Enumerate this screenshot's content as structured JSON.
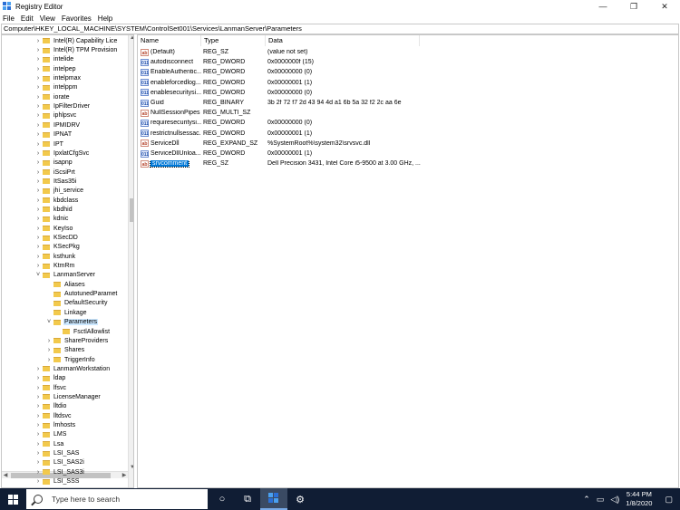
{
  "window": {
    "title": "Registry Editor",
    "controls": [
      "—",
      "❐",
      "✕"
    ]
  },
  "menu": [
    "File",
    "Edit",
    "View",
    "Favorites",
    "Help"
  ],
  "address": "Computer\\HKEY_LOCAL_MACHINE\\SYSTEM\\ControlSet001\\Services\\LanmanServer\\Parameters",
  "tree": {
    "items": [
      {
        "label": "Intel(R) Capability Lice",
        "level": 0,
        "expander": "›"
      },
      {
        "label": "Intel(R) TPM Provision",
        "level": 0,
        "expander": "›"
      },
      {
        "label": "intelide",
        "level": 0,
        "expander": "›"
      },
      {
        "label": "intelpep",
        "level": 0,
        "expander": "›"
      },
      {
        "label": "intelpmax",
        "level": 0,
        "expander": "›"
      },
      {
        "label": "intelppm",
        "level": 0,
        "expander": "›"
      },
      {
        "label": "iorate",
        "level": 0,
        "expander": "›"
      },
      {
        "label": "IpFilterDriver",
        "level": 0,
        "expander": "›"
      },
      {
        "label": "iphlpsvc",
        "level": 0,
        "expander": "›"
      },
      {
        "label": "IPMIDRV",
        "level": 0,
        "expander": "›"
      },
      {
        "label": "IPNAT",
        "level": 0,
        "expander": "›"
      },
      {
        "label": "IPT",
        "level": 0,
        "expander": "›"
      },
      {
        "label": "IpxlatCfgSvc",
        "level": 0,
        "expander": "›"
      },
      {
        "label": "isapnp",
        "level": 0,
        "expander": "›"
      },
      {
        "label": "iScsiPrt",
        "level": 0,
        "expander": "›"
      },
      {
        "label": "ItSas35i",
        "level": 0,
        "expander": "›"
      },
      {
        "label": "jhi_service",
        "level": 0,
        "expander": "›"
      },
      {
        "label": "kbdclass",
        "level": 0,
        "expander": "›"
      },
      {
        "label": "kbdhid",
        "level": 0,
        "expander": "›"
      },
      {
        "label": "kdnic",
        "level": 0,
        "expander": "›"
      },
      {
        "label": "KeyIso",
        "level": 0,
        "expander": "›"
      },
      {
        "label": "KSecDD",
        "level": 0,
        "expander": "›"
      },
      {
        "label": "KSecPkg",
        "level": 0,
        "expander": "›"
      },
      {
        "label": "ksthunk",
        "level": 0,
        "expander": "›"
      },
      {
        "label": "KtmRm",
        "level": 0,
        "expander": "›"
      },
      {
        "label": "LanmanServer",
        "level": 0,
        "expander": "˅"
      },
      {
        "label": "Aliases",
        "level": 1,
        "expander": ""
      },
      {
        "label": "AutotunedParamet",
        "level": 1,
        "expander": ""
      },
      {
        "label": "DefaultSecurity",
        "level": 1,
        "expander": ""
      },
      {
        "label": "Linkage",
        "level": 1,
        "expander": ""
      },
      {
        "label": "Parameters",
        "level": 1,
        "expander": "˅",
        "selected": true
      },
      {
        "label": "FsctlAllowlist",
        "level": 2,
        "expander": ""
      },
      {
        "label": "ShareProviders",
        "level": 1,
        "expander": "›"
      },
      {
        "label": "Shares",
        "level": 1,
        "expander": "›"
      },
      {
        "label": "TriggerInfo",
        "level": 1,
        "expander": "›"
      },
      {
        "label": "LanmanWorkstation",
        "level": 0,
        "expander": "›"
      },
      {
        "label": "ldap",
        "level": 0,
        "expander": "›"
      },
      {
        "label": "lfsvc",
        "level": 0,
        "expander": "›"
      },
      {
        "label": "LicenseManager",
        "level": 0,
        "expander": "›"
      },
      {
        "label": "lltdio",
        "level": 0,
        "expander": "›"
      },
      {
        "label": "lltdsvc",
        "level": 0,
        "expander": "›"
      },
      {
        "label": "lmhosts",
        "level": 0,
        "expander": "›"
      },
      {
        "label": "LMS",
        "level": 0,
        "expander": "›"
      },
      {
        "label": "Lsa",
        "level": 0,
        "expander": "›"
      },
      {
        "label": "LSI_SAS",
        "level": 0,
        "expander": "›"
      },
      {
        "label": "LSI_SAS2i",
        "level": 0,
        "expander": "›"
      },
      {
        "label": "LSI_SAS3i",
        "level": 0,
        "expander": "›"
      },
      {
        "label": "LSI_SSS",
        "level": 0,
        "expander": "›"
      }
    ]
  },
  "values": {
    "columns": [
      "Name",
      "Type",
      "Data"
    ],
    "rows": [
      {
        "name": "(Default)",
        "type": "REG_SZ",
        "data": "(value not set)",
        "icon": "sz"
      },
      {
        "name": "autodisconnect",
        "type": "REG_DWORD",
        "data": "0x0000000f (15)",
        "icon": "bin"
      },
      {
        "name": "EnableAuthentic...",
        "type": "REG_DWORD",
        "data": "0x00000000 (0)",
        "icon": "bin"
      },
      {
        "name": "enableforcedlog...",
        "type": "REG_DWORD",
        "data": "0x00000001 (1)",
        "icon": "bin"
      },
      {
        "name": "enablesecuritysi...",
        "type": "REG_DWORD",
        "data": "0x00000000 (0)",
        "icon": "bin"
      },
      {
        "name": "Guid",
        "type": "REG_BINARY",
        "data": "3b 2f 72 f7 2d 43 94 4d a1 6b 5a 32 f2 2c aa 6e",
        "icon": "bin"
      },
      {
        "name": "NullSessionPipes",
        "type": "REG_MULTI_SZ",
        "data": "",
        "icon": "sz"
      },
      {
        "name": "requiresecuritysi...",
        "type": "REG_DWORD",
        "data": "0x00000000 (0)",
        "icon": "bin"
      },
      {
        "name": "restrictnullsessac...",
        "type": "REG_DWORD",
        "data": "0x00000001 (1)",
        "icon": "bin"
      },
      {
        "name": "ServiceDll",
        "type": "REG_EXPAND_SZ",
        "data": "%SystemRoot%\\system32\\srvsvc.dll",
        "icon": "sz"
      },
      {
        "name": "ServiceDllUnloa...",
        "type": "REG_DWORD",
        "data": "0x00000001 (1)",
        "icon": "bin"
      },
      {
        "name": "srvcomment",
        "type": "REG_SZ",
        "data": "Dell Precision 3431, Intel Core i5-9500 at 3.00 GHz, ...",
        "icon": "sz",
        "selected": true
      }
    ]
  },
  "taskbar": {
    "search_placeholder": "Type here to search",
    "time": "5:44 PM",
    "date": "1/8/2020"
  }
}
